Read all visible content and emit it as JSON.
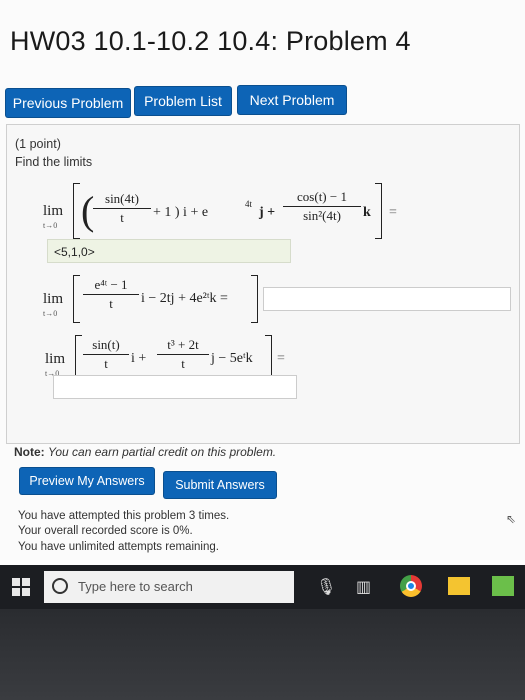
{
  "page": {
    "title": "HW03 10.1-10.2 10.4: Problem 4"
  },
  "nav": {
    "previous": "Previous Problem",
    "list": "Problem List",
    "next": "Next Problem"
  },
  "problem": {
    "points": "(1 point)",
    "instruction": "Find the limits",
    "answer1": "<5,1,0>",
    "answer2": "",
    "answer3": ""
  },
  "math": {
    "lim": "lim",
    "lim_sub": "t→0",
    "p1_num1": "sin(4t)",
    "p1_den1": "t",
    "p1_mid": "+ 1 ) i + e",
    "p1_exp": "4t",
    "p1_j": "j +",
    "p1_num2": "cos(t) − 1",
    "p1_den2": "sin²(4t)",
    "p1_k": "k",
    "eq": "=",
    "p2_num": "e⁴ᵗ − 1",
    "p2_den": "t",
    "p2_rest": "i − 2tj + 4e²ᵗk =",
    "p3_num1": "sin(t)",
    "p3_den1": "t",
    "p3_mid": "i +",
    "p3_num2": "t³ + 2t",
    "p3_den2": "t",
    "p3_rest": "j − 5eᵗk",
    "i_vec": "i"
  },
  "note": {
    "label": "Note:",
    "text": "You can earn partial credit on this problem."
  },
  "actions": {
    "preview": "Preview My Answers",
    "submit": "Submit Answers"
  },
  "status": {
    "line1": "You have attempted this problem 3 times.",
    "line2": "Your overall recorded score is 0%.",
    "line3": "You have unlimited attempts remaining."
  },
  "taskbar": {
    "search_placeholder": "Type here to search"
  },
  "colors": {
    "button_blue": "#0d64b6",
    "answer_green": "#eef3e4",
    "taskbar": "#1c1e22"
  }
}
